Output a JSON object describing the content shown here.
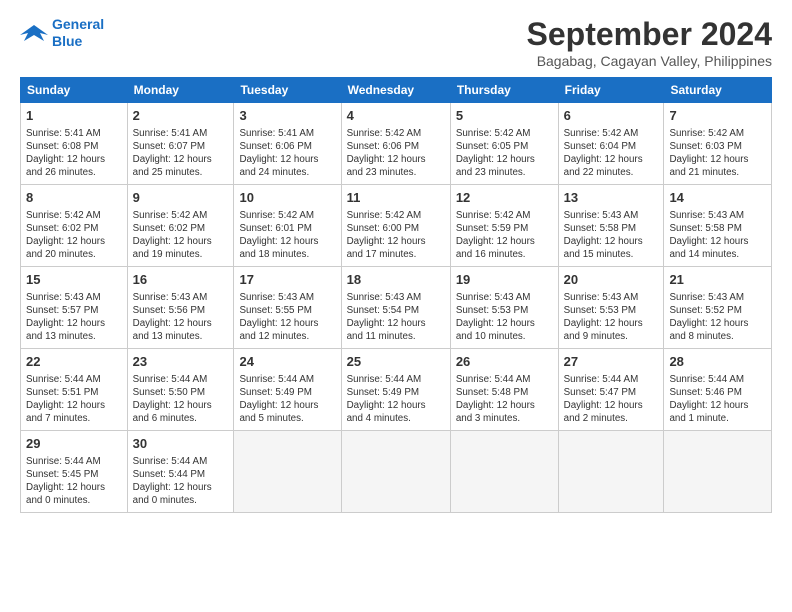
{
  "logo": {
    "line1": "General",
    "line2": "Blue"
  },
  "title": "September 2024",
  "location": "Bagabag, Cagayan Valley, Philippines",
  "headers": [
    "Sunday",
    "Monday",
    "Tuesday",
    "Wednesday",
    "Thursday",
    "Friday",
    "Saturday"
  ],
  "weeks": [
    [
      {
        "day": "1",
        "info": "Sunrise: 5:41 AM\nSunset: 6:08 PM\nDaylight: 12 hours\nand 26 minutes."
      },
      {
        "day": "2",
        "info": "Sunrise: 5:41 AM\nSunset: 6:07 PM\nDaylight: 12 hours\nand 25 minutes."
      },
      {
        "day": "3",
        "info": "Sunrise: 5:41 AM\nSunset: 6:06 PM\nDaylight: 12 hours\nand 24 minutes."
      },
      {
        "day": "4",
        "info": "Sunrise: 5:42 AM\nSunset: 6:06 PM\nDaylight: 12 hours\nand 23 minutes."
      },
      {
        "day": "5",
        "info": "Sunrise: 5:42 AM\nSunset: 6:05 PM\nDaylight: 12 hours\nand 23 minutes."
      },
      {
        "day": "6",
        "info": "Sunrise: 5:42 AM\nSunset: 6:04 PM\nDaylight: 12 hours\nand 22 minutes."
      },
      {
        "day": "7",
        "info": "Sunrise: 5:42 AM\nSunset: 6:03 PM\nDaylight: 12 hours\nand 21 minutes."
      }
    ],
    [
      {
        "day": "8",
        "info": "Sunrise: 5:42 AM\nSunset: 6:02 PM\nDaylight: 12 hours\nand 20 minutes."
      },
      {
        "day": "9",
        "info": "Sunrise: 5:42 AM\nSunset: 6:02 PM\nDaylight: 12 hours\nand 19 minutes."
      },
      {
        "day": "10",
        "info": "Sunrise: 5:42 AM\nSunset: 6:01 PM\nDaylight: 12 hours\nand 18 minutes."
      },
      {
        "day": "11",
        "info": "Sunrise: 5:42 AM\nSunset: 6:00 PM\nDaylight: 12 hours\nand 17 minutes."
      },
      {
        "day": "12",
        "info": "Sunrise: 5:42 AM\nSunset: 5:59 PM\nDaylight: 12 hours\nand 16 minutes."
      },
      {
        "day": "13",
        "info": "Sunrise: 5:43 AM\nSunset: 5:58 PM\nDaylight: 12 hours\nand 15 minutes."
      },
      {
        "day": "14",
        "info": "Sunrise: 5:43 AM\nSunset: 5:58 PM\nDaylight: 12 hours\nand 14 minutes."
      }
    ],
    [
      {
        "day": "15",
        "info": "Sunrise: 5:43 AM\nSunset: 5:57 PM\nDaylight: 12 hours\nand 13 minutes."
      },
      {
        "day": "16",
        "info": "Sunrise: 5:43 AM\nSunset: 5:56 PM\nDaylight: 12 hours\nand 13 minutes."
      },
      {
        "day": "17",
        "info": "Sunrise: 5:43 AM\nSunset: 5:55 PM\nDaylight: 12 hours\nand 12 minutes."
      },
      {
        "day": "18",
        "info": "Sunrise: 5:43 AM\nSunset: 5:54 PM\nDaylight: 12 hours\nand 11 minutes."
      },
      {
        "day": "19",
        "info": "Sunrise: 5:43 AM\nSunset: 5:53 PM\nDaylight: 12 hours\nand 10 minutes."
      },
      {
        "day": "20",
        "info": "Sunrise: 5:43 AM\nSunset: 5:53 PM\nDaylight: 12 hours\nand 9 minutes."
      },
      {
        "day": "21",
        "info": "Sunrise: 5:43 AM\nSunset: 5:52 PM\nDaylight: 12 hours\nand 8 minutes."
      }
    ],
    [
      {
        "day": "22",
        "info": "Sunrise: 5:44 AM\nSunset: 5:51 PM\nDaylight: 12 hours\nand 7 minutes."
      },
      {
        "day": "23",
        "info": "Sunrise: 5:44 AM\nSunset: 5:50 PM\nDaylight: 12 hours\nand 6 minutes."
      },
      {
        "day": "24",
        "info": "Sunrise: 5:44 AM\nSunset: 5:49 PM\nDaylight: 12 hours\nand 5 minutes."
      },
      {
        "day": "25",
        "info": "Sunrise: 5:44 AM\nSunset: 5:49 PM\nDaylight: 12 hours\nand 4 minutes."
      },
      {
        "day": "26",
        "info": "Sunrise: 5:44 AM\nSunset: 5:48 PM\nDaylight: 12 hours\nand 3 minutes."
      },
      {
        "day": "27",
        "info": "Sunrise: 5:44 AM\nSunset: 5:47 PM\nDaylight: 12 hours\nand 2 minutes."
      },
      {
        "day": "28",
        "info": "Sunrise: 5:44 AM\nSunset: 5:46 PM\nDaylight: 12 hours\nand 1 minute."
      }
    ],
    [
      {
        "day": "29",
        "info": "Sunrise: 5:44 AM\nSunset: 5:45 PM\nDaylight: 12 hours\nand 0 minutes."
      },
      {
        "day": "30",
        "info": "Sunrise: 5:44 AM\nSunset: 5:44 PM\nDaylight: 12 hours\nand 0 minutes."
      },
      {
        "day": "",
        "info": ""
      },
      {
        "day": "",
        "info": ""
      },
      {
        "day": "",
        "info": ""
      },
      {
        "day": "",
        "info": ""
      },
      {
        "day": "",
        "info": ""
      }
    ]
  ]
}
